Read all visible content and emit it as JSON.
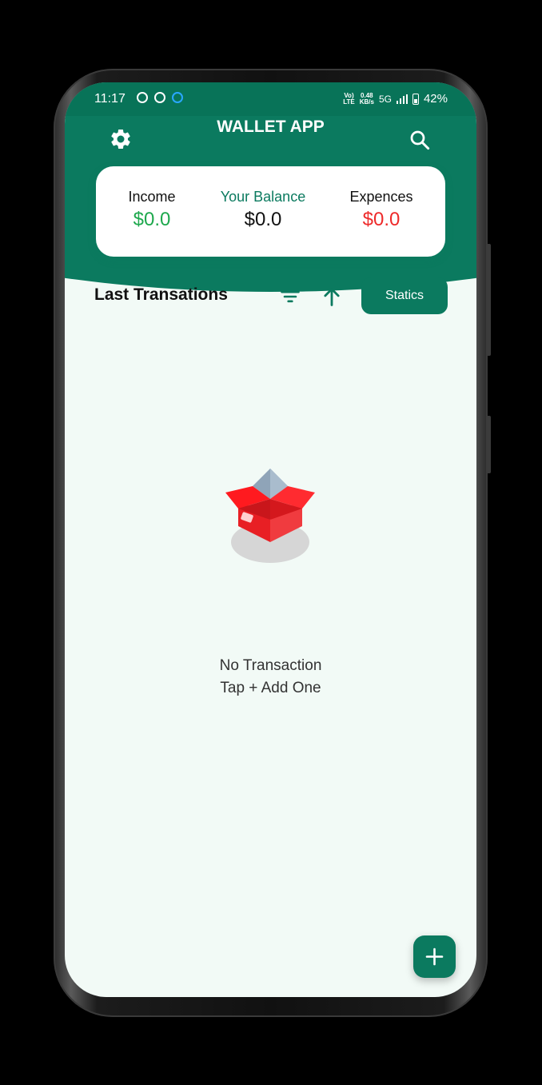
{
  "status_bar": {
    "time": "11:17",
    "network_top": "Vo)",
    "network_bottom": "LTE",
    "speed_top": "0.48",
    "speed_bottom": "KB/s",
    "signal": "5G",
    "battery": "42%"
  },
  "header": {
    "title": "WALLET APP",
    "settings_icon": "gear-icon",
    "search_icon": "search-icon"
  },
  "summary": {
    "income_label": "Income",
    "income_value": "$0.0",
    "balance_label": "Your Balance",
    "balance_value": "$0.0",
    "expense_label": "Expences",
    "expense_value": "$0.0"
  },
  "transactions": {
    "title": "Last Transations",
    "filter_icon": "filter-icon",
    "sort_icon": "arrow-up-icon",
    "statics_label": "Statics"
  },
  "empty_state": {
    "illustration": "open-box-illustration",
    "title": "No Transaction",
    "subtitle": "Tap + Add One"
  },
  "fab": {
    "icon": "plus-icon"
  },
  "colors": {
    "primary": "#0b7a5f",
    "income": "#1ea84d",
    "expense": "#ee2a2a",
    "background": "#f2faf6"
  }
}
